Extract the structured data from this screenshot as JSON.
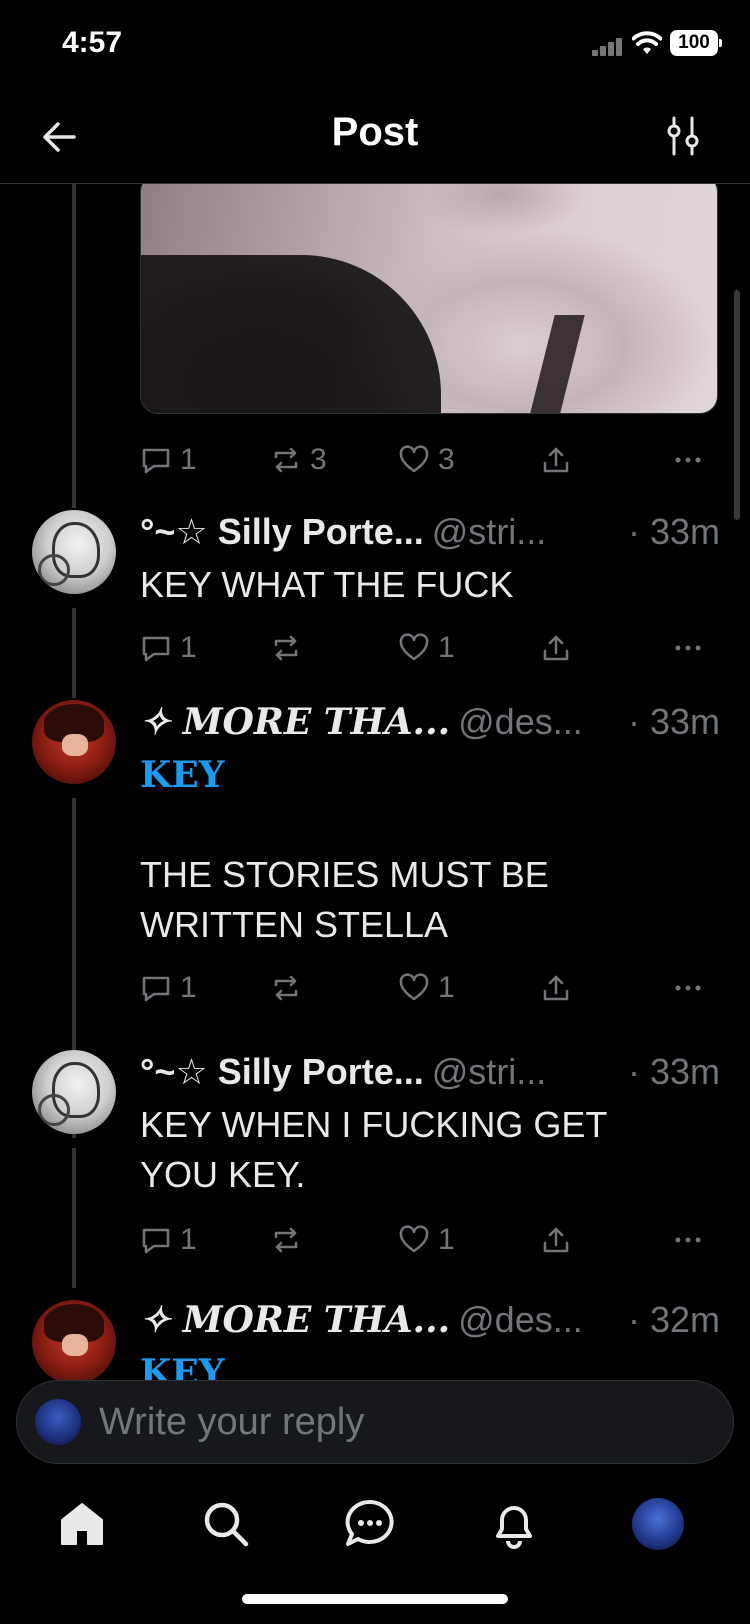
{
  "status_bar": {
    "time": "4:57",
    "battery": "100"
  },
  "header": {
    "title": "Post"
  },
  "media_post": {
    "actions": {
      "replies": "1",
      "reposts": "3",
      "likes": "3"
    }
  },
  "tweets": [
    {
      "name": "°~☆ Silly Porte...",
      "handle": "@stri...",
      "time": "· 33m",
      "text": "KEY WHAT THE FUCK",
      "mention": "",
      "actions": {
        "replies": "1",
        "reposts": "",
        "likes": "1"
      }
    },
    {
      "name": "✧ 𝑴𝑶𝑹𝑬 𝑻𝑯𝑨...",
      "handle": "@des...",
      "time": "· 33m",
      "mention": "𝐊𝐄𝐘",
      "text": "THE STORIES MUST BE WRITTEN STELLA",
      "actions": {
        "replies": "1",
        "reposts": "",
        "likes": "1"
      }
    },
    {
      "name": "°~☆ Silly Porte...",
      "handle": "@stri...",
      "time": "· 33m",
      "text": "KEY WHEN I FUCKING GET YOU KEY.",
      "mention": "",
      "actions": {
        "replies": "1",
        "reposts": "",
        "likes": "1"
      }
    },
    {
      "name": "✧ 𝑴𝑶𝑹𝑬 𝑻𝑯𝑨...",
      "handle": "@des...",
      "time": "· 32m",
      "mention": "𝐊𝐄𝐘",
      "text": ""
    }
  ],
  "reply_bar": {
    "placeholder": "Write your reply"
  },
  "tab_bar": {
    "items": [
      "home",
      "search",
      "messages",
      "notifications",
      "profile"
    ]
  },
  "colors": {
    "background": "#000000",
    "accent": "#1d9bf0",
    "muted": "#71767b",
    "text": "#e7e9ea"
  }
}
